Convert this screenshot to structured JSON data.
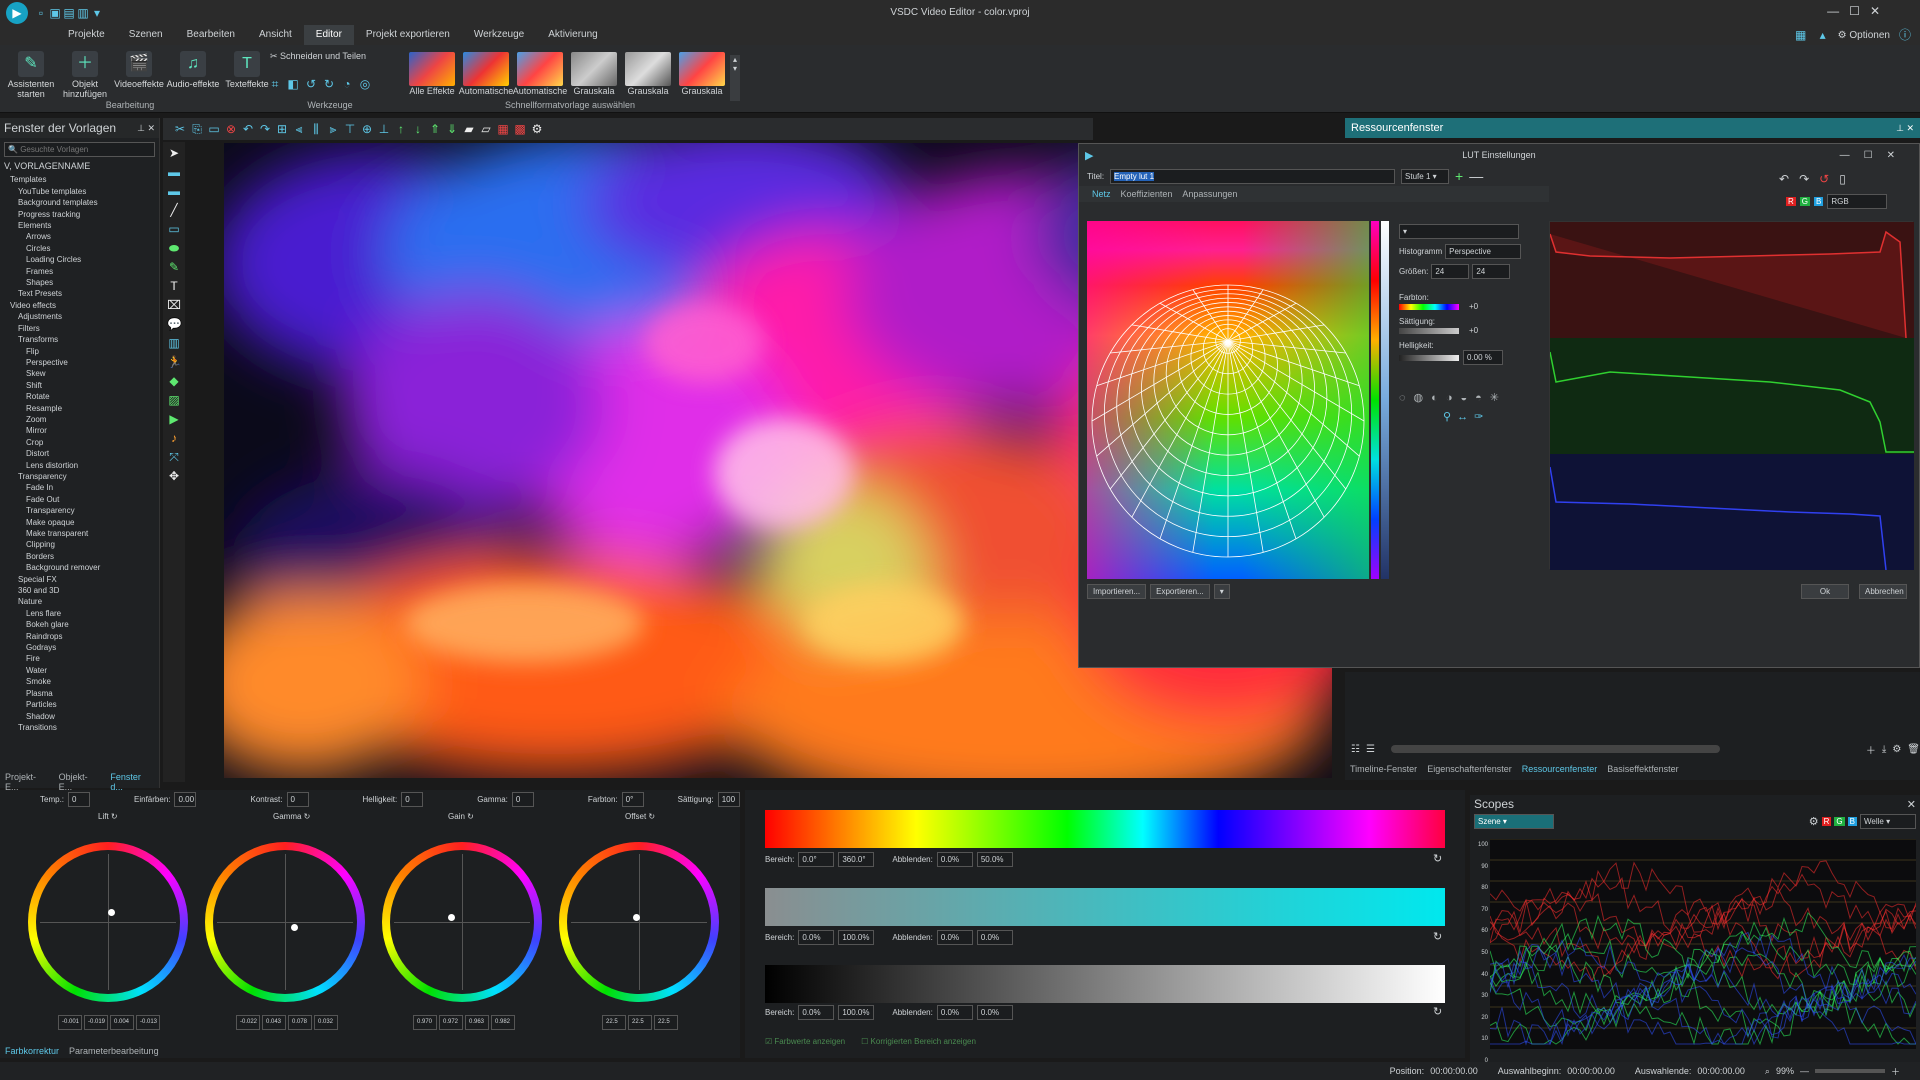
{
  "app": {
    "title": "VSDC Video Editor - color.vproj",
    "options_label": "Optionen"
  },
  "menu": [
    "Projekte",
    "Szenen",
    "Bearbeiten",
    "Ansicht",
    "Editor",
    "Projekt exportieren",
    "Werkzeuge",
    "Aktivierung"
  ],
  "ribbon": {
    "buttons": [
      {
        "label": "Assistenten starten",
        "icon": "wand-icon"
      },
      {
        "label": "Objekt hinzufügen",
        "icon": "add-object-icon"
      },
      {
        "label": "Videoeffekte",
        "icon": "video-effects-icon"
      },
      {
        "label": "Audio-effekte",
        "icon": "audio-effects-icon"
      },
      {
        "label": "Texteffekte",
        "icon": "text-effects-icon"
      }
    ],
    "group_bearbeitung": "Bearbeitung",
    "cut_split": "Schneiden und Teilen",
    "group_werkzeuge": "Werkzeuge",
    "presets": [
      "Alle Effekte",
      "Automatische",
      "Automatische",
      "Grauskala",
      "Grauskala",
      "Grauskala"
    ],
    "group_presets": "Schnellformatvorlage auswählen"
  },
  "templates": {
    "title": "Fenster der Vorlagen",
    "search_placeholder": "Gesuchte Vorlagen",
    "header": "VORLAGENNAME",
    "items": [
      "Templates",
      "YouTube templates",
      "Background templates",
      "Progress tracking",
      "Elements",
      "Arrows",
      "Circles",
      "Loading Circles",
      "Frames",
      "Shapes",
      "Text Presets",
      "Video effects",
      "Adjustments",
      "Filters",
      "Transforms",
      "Flip",
      "Perspective",
      "Skew",
      "Shift",
      "Rotate",
      "Resample",
      "Zoom",
      "Mirror",
      "Crop",
      "Distort",
      "Lens distortion",
      "Transparency",
      "Fade In",
      "Fade Out",
      "Transparency",
      "Make opaque",
      "Make transparent",
      "Clipping",
      "Borders",
      "Background remover",
      "Special FX",
      "360 and 3D",
      "Nature",
      "Lens flare",
      "Bokeh glare",
      "Raindrops",
      "Godrays",
      "Fire",
      "Water",
      "Smoke",
      "Plasma",
      "Particles",
      "Shadow",
      "Transitions"
    ],
    "tabs": [
      "Projekt-E...",
      "Objekt-E...",
      "Fenster d..."
    ]
  },
  "resource": {
    "title": "Ressourcenfenster",
    "tabs": [
      "Timeline-Fenster",
      "Eigenschaftenfenster",
      "Ressourcenfenster",
      "Basiseffektfenster"
    ]
  },
  "lut": {
    "title": "LUT Einstellungen",
    "name_label": "Titel:",
    "name_value": "Empty lut 1",
    "stage": "Stufe 1",
    "tabs": [
      "Netz",
      "Koeffizienten",
      "Anpassungen"
    ],
    "histogram_label": "Histogramm",
    "histogram_value": "Perspective",
    "size_label": "Größen:",
    "size_a": "24",
    "size_b": "24",
    "hue_label": "Farbton:",
    "sat_label": "Sättigung:",
    "bright_label": "Helligkeit:",
    "bright_value": "0.00 %",
    "hue_value": "+0",
    "sat_value": "+0",
    "import": "Importieren...",
    "export": "Exportieren...",
    "channel": "RGB",
    "ok": "Ok",
    "cancel": "Abbrechen"
  },
  "colorcorr": {
    "temp_label": "Temp.:",
    "temp": "0",
    "tint_label": "Einfärben:",
    "tint": "0.00",
    "contrast_label": "Kontrast:",
    "contrast": "0",
    "bright_label": "Helligkeit:",
    "bright": "0",
    "gamma_label": "Gamma:",
    "gamma": "0",
    "hue_label": "Farbton:",
    "hue": "0°",
    "sat_label": "Sättigung:",
    "sat": "100",
    "wheels": [
      {
        "name": "Lift",
        "vals": [
          "-0.001",
          "-0.019",
          "0.004",
          "-0.013"
        ]
      },
      {
        "name": "Gamma",
        "vals": [
          "-0.022",
          "0.043",
          "0.078",
          "0.032"
        ]
      },
      {
        "name": "Gain",
        "vals": [
          "0.970",
          "0.972",
          "0.963",
          "0.982"
        ]
      },
      {
        "name": "Offset",
        "vals": [
          "22.5",
          "22.5",
          "22.5"
        ]
      }
    ],
    "tabs": [
      "Farbkorrektur",
      "Parameterbearbeitung"
    ]
  },
  "curves": {
    "range_label": "Bereich:",
    "fade_label": "Abblenden:",
    "rows": [
      {
        "r1": "0.0°",
        "r2": "360.0°",
        "f1": "0.0%",
        "f2": "50.0%"
      },
      {
        "r1": "0.0%",
        "r2": "100.0%",
        "f1": "0.0%",
        "f2": "0.0%"
      },
      {
        "r1": "0.0%",
        "r2": "100.0%",
        "f1": "0.0%",
        "f2": "0.0%"
      }
    ],
    "chk1": "Farbwerte anzeigen",
    "chk2": "Korrigierten Bereich anzeigen"
  },
  "scopes": {
    "title": "Scopes",
    "source": "Szene",
    "mode": "Welle",
    "scale": [
      "100",
      "90",
      "80",
      "70",
      "60",
      "50",
      "40",
      "30",
      "20",
      "10",
      "0"
    ]
  },
  "status": {
    "position_label": "Position:",
    "position": "00:00:00.00",
    "sel_start_label": "Auswahlbeginn:",
    "sel_start": "00:00:00.00",
    "sel_end_label": "Auswahlende:",
    "sel_end": "00:00:00.00",
    "zoom": "99%"
  }
}
